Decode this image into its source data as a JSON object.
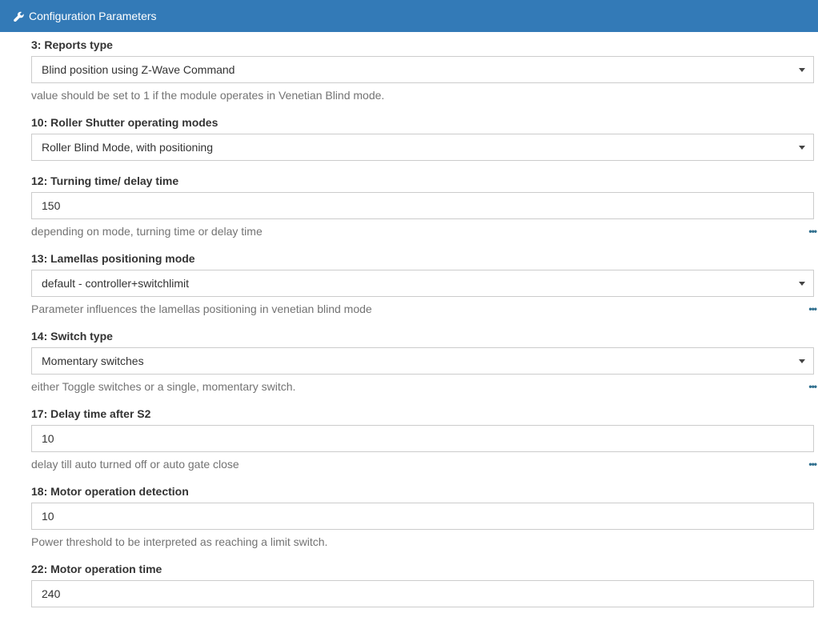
{
  "header": {
    "title": "Configuration Parameters",
    "icon": "wrench-icon"
  },
  "params": [
    {
      "label": "3: Reports type",
      "type": "select",
      "value": "Blind position using Z-Wave Command",
      "help": "value should be set to 1 if the module operates in Venetian Blind mode.",
      "more": false
    },
    {
      "label": "10: Roller Shutter operating modes",
      "type": "select",
      "value": "Roller Blind Mode, with positioning",
      "help": null,
      "more": false
    },
    {
      "label": "12: Turning time/ delay time",
      "type": "input",
      "value": "150",
      "help": "depending on mode, turning time or delay time",
      "more": true
    },
    {
      "label": "13: Lamellas positioning mode",
      "type": "select",
      "value": "default - controller+switchlimit",
      "help": "Parameter influences the lamellas positioning in venetian blind mode",
      "more": true
    },
    {
      "label": "14: Switch type",
      "type": "select",
      "value": "Momentary switches",
      "help": "either Toggle switches or a single, momentary switch.",
      "more": true
    },
    {
      "label": "17: Delay time after S2",
      "type": "input",
      "value": "10",
      "help": "delay till auto turned off or auto gate close",
      "more": true
    },
    {
      "label": "18: Motor operation detection",
      "type": "input",
      "value": "10",
      "help": "Power threshold to be interpreted as reaching a limit switch.",
      "more": false
    },
    {
      "label": "22: Motor operation time",
      "type": "input",
      "value": "240",
      "help": null,
      "more": false
    }
  ],
  "more_glyph": "•••"
}
